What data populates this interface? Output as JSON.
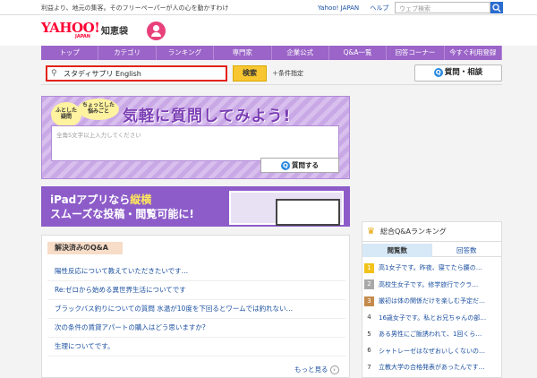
{
  "topbar": {
    "tagline": "利益より、地元の集客。そのフリーペーパーが人の心を動かすわけ",
    "links": [
      "Yahoo! JAPAN",
      "ヘルプ"
    ],
    "search_placeholder": "ウェブ検索"
  },
  "header": {
    "logo": "YAHOO!",
    "logo_sub": "JAPAN",
    "service": "知恵袋"
  },
  "nav": {
    "items": [
      "トップ",
      "カテゴリ",
      "ランキング",
      "専門家",
      "企業公式",
      "Q&A一覧",
      "回答コーナー",
      "今すぐ利用登録"
    ]
  },
  "search": {
    "value": "スタディサプリ English",
    "button": "検索",
    "conditions": "＋条件指定",
    "ask_button": "質問・相談",
    "ask_badge": "Q"
  },
  "banner": {
    "bubble1": "ふとした\n疑問",
    "bubble2": "ちょっとした\n悩みごと",
    "title": "気軽に質問してみよう!",
    "placeholder": "全角5文字以上入力してください",
    "ask_label": "質問する",
    "ask_badge": "Q"
  },
  "ipad": {
    "line1_a": "iPadアプリなら",
    "line1_b": "縦横",
    "line2": "スムーズな投稿・閲覧可能に!"
  },
  "solved": {
    "title": "解決済みのQ&A",
    "items": [
      "陽性反応について教えていただきたいです…",
      "Re:ゼロから始める異世界生活についてです",
      "ブラックバス釣りについての質問 水温が10度を下回るとワームでは釣れない…",
      "次の条件の賃貸アパートの購入はどう思いますか?",
      "生理についてです。"
    ],
    "more": "もっと見る",
    "more_icon": "›"
  },
  "ranking": {
    "title": "総合Q&Aランキング",
    "crown_icon": "♛",
    "tabs": [
      "閲覧数",
      "回答数"
    ],
    "items": [
      {
        "rank": "1",
        "text": "高1女子です。昨夜、寝てたら腰の…"
      },
      {
        "rank": "2",
        "text": "高校生女子です。修学旅行でクラ…"
      },
      {
        "rank": "3",
        "text": "厳初は体の関係だけを楽しむ予定だ…"
      },
      {
        "rank": "4",
        "text": "16歳女子です。私とお兄ちゃんの部…"
      },
      {
        "rank": "5",
        "text": "ある男性にご飯誘われて、1回くら…"
      },
      {
        "rank": "6",
        "text": "シャトレーゼはなぜおいしくないの…"
      },
      {
        "rank": "7",
        "text": "立教大学の合格発表があったんです…"
      }
    ]
  },
  "colors": {
    "nav": "#9b64c8",
    "accent_red": "#e2231a",
    "search_button": "#f7c630",
    "link": "#1a4fa0"
  }
}
